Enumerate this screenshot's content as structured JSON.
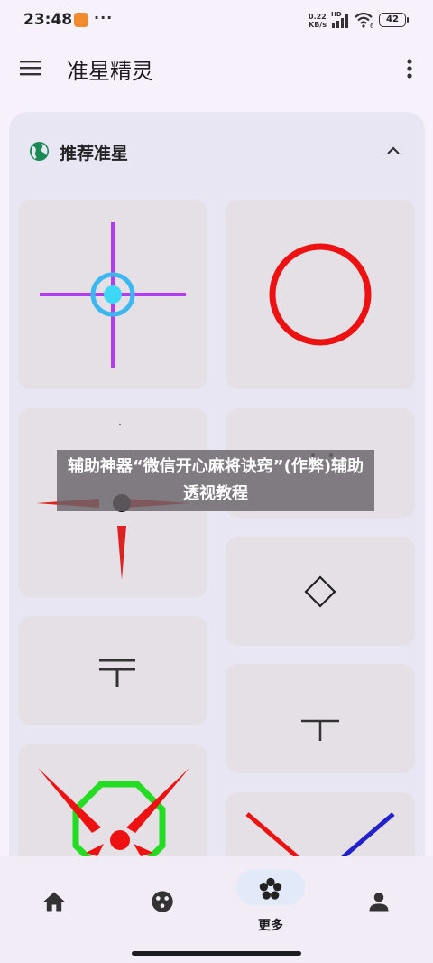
{
  "status_bar": {
    "time": "23:48",
    "dots": "···",
    "net_speed_value": "0.22",
    "net_speed_unit": "KB/s",
    "network_type": "HD",
    "wifi_badge": "6",
    "battery": "42"
  },
  "app_bar": {
    "title": "准星精灵"
  },
  "section": {
    "title": "推荐准星"
  },
  "crosshairs": [
    {
      "name": "blue-circle-purple-cross",
      "colors": [
        "#b23cf0",
        "#3cc0f0"
      ]
    },
    {
      "name": "red-ring",
      "colors": [
        "#ee1111"
      ]
    },
    {
      "name": "red-dart-black-dot",
      "colors": [
        "#dd2222",
        "#111111"
      ]
    },
    {
      "name": "partial-dots",
      "colors": [
        "#333333"
      ]
    },
    {
      "name": "diamond-outline",
      "colors": [
        "#222222"
      ]
    },
    {
      "name": "double-bar-t",
      "colors": [
        "#333333"
      ]
    },
    {
      "name": "t-shape",
      "colors": [
        "#333333"
      ]
    },
    {
      "name": "green-octagon-red-darts",
      "colors": [
        "#22dd22",
        "#ee1111"
      ]
    },
    {
      "name": "red-blue-x",
      "colors": [
        "#ee1111",
        "#2222cc"
      ]
    }
  ],
  "watermark_text": "辅助神器“微信开心麻将诀窍”(作弊)辅助透视教程",
  "bottom_nav": {
    "items": [
      {
        "icon": "home-icon",
        "label": ""
      },
      {
        "icon": "gamepad-icon",
        "label": ""
      },
      {
        "icon": "flower-icon",
        "label": "更多",
        "active": true
      },
      {
        "icon": "person-icon",
        "label": ""
      }
    ]
  },
  "colors": {
    "background": "#f7f1fb",
    "card": "#e9e6f3",
    "tile": "#e5e0e6",
    "nav_pill": "#e2e9f8"
  }
}
